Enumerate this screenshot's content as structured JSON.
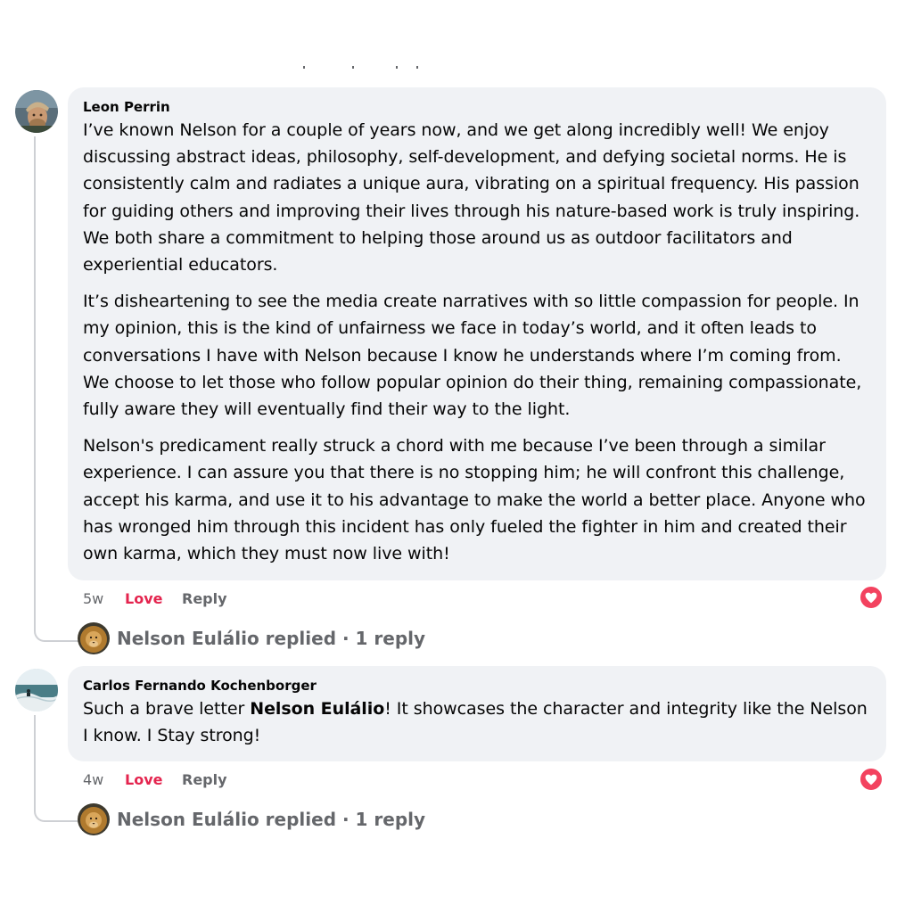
{
  "comments": [
    {
      "author": "Leon Perrin",
      "paragraphs": [
        "I’ve known Nelson for a couple of years now, and we get along incredibly well! We enjoy discussing abstract ideas, philosophy, self-development, and defying societal norms. He is consistently calm and radiates a unique aura, vibrating on a spiritual frequency. His passion for guiding others and improving their lives through his nature-based work is truly inspiring. We both share a commitment to helping those around us as outdoor facilitators and experiential educators.",
        "It’s disheartening to see the media create narratives with so little compassion for people. In my opinion, this is the kind of unfairness we face in today’s world, and it often leads to conversations I have with Nelson because I know he understands where I’m coming from. We choose to let those who follow popular opinion do their thing, remaining compassionate, fully aware they will eventually find their way to the light.",
        "Nelson's predicament really struck a chord with me because I’ve been through a similar experience. I can assure you that there is no stopping him; he will confront this challenge, accept his karma, and use it to his advantage to make the world a better place. Anyone who has wronged him through this incident has only fueled the fighter in him and created their own karma, which they must now live with!"
      ],
      "time": "5w",
      "love_label": "Love",
      "reply_label": "Reply",
      "replies_summary": "Nelson Eulálio replied · 1 reply"
    },
    {
      "author": "Carlos Fernando Kochenborger",
      "text_before": "Such a brave letter ",
      "mention": "Nelson Eulálio",
      "text_after": "! It showcases the character and integrity like the Nelson I know. I Stay strong!",
      "time": "4w",
      "love_label": "Love",
      "reply_label": "Reply",
      "replies_summary": "Nelson Eulálio replied · 1 reply"
    }
  ],
  "icons": {
    "reaction": "heart-icon",
    "avatar_1": "avatar-leon",
    "avatar_2": "avatar-carlos",
    "reply_avatar": "avatar-nelson-lion"
  },
  "colors": {
    "bubble": "#f0f2f5",
    "love": "#e4244e",
    "heart": "#f3425f",
    "meta": "#65676b"
  }
}
